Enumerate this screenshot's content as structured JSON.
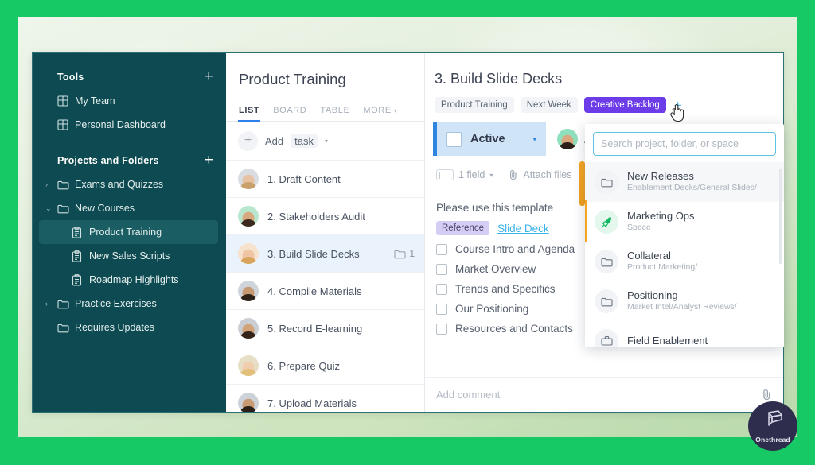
{
  "theme": {
    "frame_green": "#17c964",
    "sidebar_bg": "#0e4a51",
    "accent_blue": "#2f86e0",
    "tag_purple": "#6c3ce9",
    "priority_orange": "#f5a623",
    "link_blue": "#3bb2e8"
  },
  "sidebar": {
    "tools_header": "Tools",
    "tools_add": "+",
    "tools": [
      {
        "label": "My Team",
        "icon": "grid-icon"
      },
      {
        "label": "Personal Dashboard",
        "icon": "grid-icon"
      }
    ],
    "projects_header": "Projects and Folders",
    "projects_add": "+",
    "items": [
      {
        "label": "Exams and Quizzes",
        "icon": "folder-icon",
        "caret": "›",
        "level": 1,
        "active": false
      },
      {
        "label": "New Courses",
        "icon": "folder-icon",
        "caret": "⌄",
        "level": 1,
        "active": false
      },
      {
        "label": "Product Training",
        "icon": "clipboard-icon",
        "caret": "",
        "level": 2,
        "active": true
      },
      {
        "label": "New Sales Scripts",
        "icon": "clipboard-icon",
        "caret": "",
        "level": 2,
        "active": false
      },
      {
        "label": "Roadmap Highlights",
        "icon": "clipboard-icon",
        "caret": "",
        "level": 2,
        "active": false
      },
      {
        "label": "Practice Exercises",
        "icon": "folder-icon",
        "caret": "›",
        "level": 1,
        "active": false
      },
      {
        "label": "Requires Updates",
        "icon": "folder-icon",
        "caret": "",
        "level": 1,
        "active": false
      }
    ]
  },
  "list": {
    "title": "Product Training",
    "tabs": [
      {
        "label": "LIST",
        "selected": true
      },
      {
        "label": "BOARD",
        "selected": false
      },
      {
        "label": "TABLE",
        "selected": false
      },
      {
        "label": "MORE",
        "selected": false,
        "caret": "▾"
      }
    ],
    "add_row": {
      "plus": "+",
      "label": "Add",
      "chip": "task",
      "caret": "▾"
    },
    "tasks": [
      {
        "name": "1. Draft Content",
        "selected": false,
        "folder_count": "",
        "avatar_skin": "#e8c2a4",
        "avatar_hair": "#c8a06a",
        "avatar_bg": "#d9dde2"
      },
      {
        "name": "2. Stakeholders Audit",
        "selected": false,
        "folder_count": "",
        "avatar_skin": "#d8a97f",
        "avatar_hair": "#3b2a1d",
        "avatar_bg": "#b9e6cf"
      },
      {
        "name": "3. Build Slide Decks",
        "selected": true,
        "folder_count": "1",
        "avatar_skin": "#f0c5a6",
        "avatar_hair": "#d8a45c",
        "avatar_bg": "#f6e2cd"
      },
      {
        "name": "4. Compile Materials",
        "selected": false,
        "folder_count": "",
        "avatar_skin": "#c89a72",
        "avatar_hair": "#2e2218",
        "avatar_bg": "#cfd4da"
      },
      {
        "name": "5. Record E-learning",
        "selected": false,
        "folder_count": "",
        "avatar_skin": "#d2a378",
        "avatar_hair": "#332318",
        "avatar_bg": "#c9ced5"
      },
      {
        "name": "6. Prepare Quiz",
        "selected": false,
        "folder_count": "",
        "avatar_skin": "#f0cdae",
        "avatar_hair": "#e3c07a",
        "avatar_bg": "#e6dfc6"
      },
      {
        "name": "7. Upload Materials",
        "selected": false,
        "folder_count": "",
        "avatar_skin": "#c99b72",
        "avatar_hair": "#2b2018",
        "avatar_bg": "#cdd2d8"
      }
    ]
  },
  "detail": {
    "title": "3. Build Slide Decks",
    "tags": [
      {
        "label": "Product Training",
        "style": "grey"
      },
      {
        "label": "Next Week",
        "style": "grey"
      },
      {
        "label": "Creative Backlog",
        "style": "purple"
      }
    ],
    "tag_add": "+",
    "status": {
      "label": "Active",
      "caret": "▾"
    },
    "assignee": {
      "name": "Aar"
    },
    "meta": [
      {
        "label": "1 field",
        "icon": "field-icon",
        "caret": "▾"
      },
      {
        "label": "Attach files",
        "icon": "paperclip-icon"
      }
    ],
    "template_text": "Please use this template",
    "reference_badge": "Reference",
    "reference_link": "Slide Deck",
    "checklist": [
      "Course Intro and Agenda",
      "Market Overview",
      "Trends and Specifics",
      "Our Positioning",
      "Resources and Contacts"
    ],
    "comment_placeholder": "Add comment",
    "comment_attach_icon": "paperclip-icon"
  },
  "dropdown": {
    "search_placeholder": "Search project, folder, or space",
    "search_value": "",
    "items": [
      {
        "title": "New Releases",
        "subtitle": "Enablement Decks/General Slides/",
        "icon": "folder-icon",
        "highlighted": true
      },
      {
        "title": "Marketing Ops",
        "subtitle": "Space",
        "icon": "rocket-icon",
        "highlighted": false
      },
      {
        "title": "Collateral",
        "subtitle": "Product Marketing/",
        "icon": "folder-icon",
        "highlighted": false
      },
      {
        "title": "Positioning",
        "subtitle": "Market Intel/Analyst Reviews/",
        "icon": "folder-icon",
        "highlighted": false
      },
      {
        "title": "Field Enablement",
        "subtitle": "",
        "icon": "briefcase-icon",
        "highlighted": false
      }
    ]
  },
  "brand": {
    "name": "Onethread",
    "icon": "onethread-logo-icon"
  }
}
